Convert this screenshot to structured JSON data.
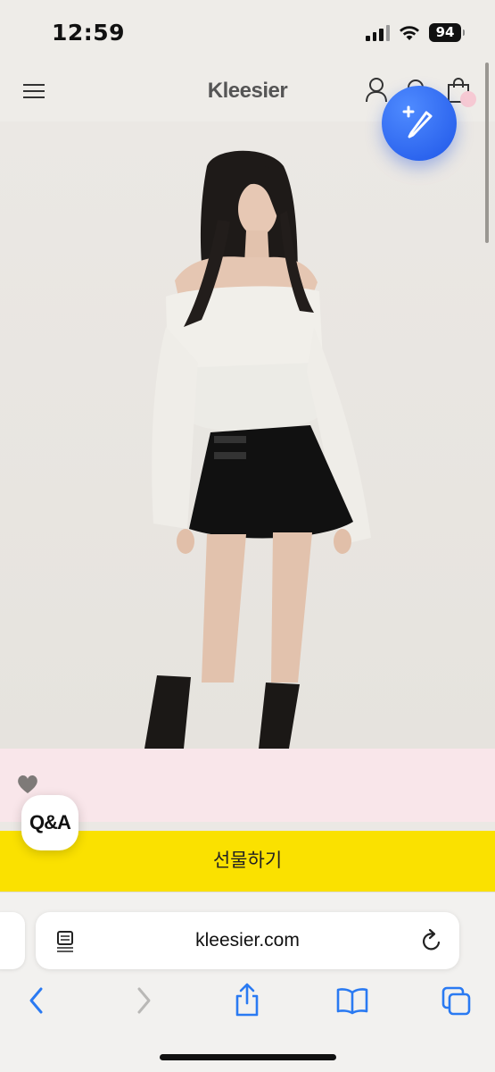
{
  "status_bar": {
    "time": "12:59",
    "battery": "94",
    "icons": [
      "signal-icon",
      "wifi-icon",
      "battery-icon"
    ]
  },
  "header": {
    "logo": "Kleesier",
    "icons": [
      "hamburger-menu-icon",
      "user-icon",
      "search-icon",
      "shopping-bag-icon"
    ]
  },
  "fab": {
    "icon": "edit-pencil-plus-icon",
    "color": "#2b63f0"
  },
  "product": {
    "image_description_icon": "model-photo",
    "heart_icon": "heart-icon"
  },
  "qa_button": {
    "label": "Q&A"
  },
  "gift_button": {
    "label": "선물하기",
    "color": "#fae100"
  },
  "browser": {
    "url": "kleesier.com",
    "toolbar": [
      "back-icon",
      "forward-icon",
      "share-icon",
      "bookmarks-icon",
      "tabs-icon"
    ]
  },
  "colors": {
    "accent": "#2b63f0",
    "gift": "#fae100",
    "pink_panel": "#f9e6ea"
  }
}
